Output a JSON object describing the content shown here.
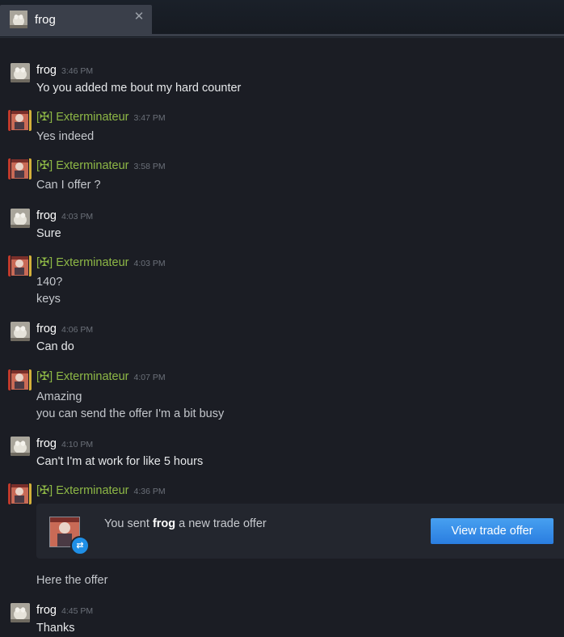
{
  "tab": {
    "label": "frog",
    "close_glyph": "✕"
  },
  "colors": {
    "background": "#1b1d24",
    "friend_name": "#ffffff",
    "other_name": "#8eb846",
    "button": "#3b8fea"
  },
  "messages": [
    {
      "author": "frog",
      "time": "3:46 PM",
      "lines": [
        "Yo you added me bout my hard counter"
      ]
    },
    {
      "author": "[✠] Exterminateur",
      "time": "3:47 PM",
      "lines": [
        "Yes indeed"
      ]
    },
    {
      "author": "[✠] Exterminateur",
      "time": "3:58 PM",
      "lines": [
        "Can I offer ?"
      ]
    },
    {
      "author": "frog",
      "time": "4:03 PM",
      "lines": [
        "Sure"
      ]
    },
    {
      "author": "[✠] Exterminateur",
      "time": "4:03 PM",
      "lines": [
        "140?",
        "keys"
      ]
    },
    {
      "author": "frog",
      "time": "4:06 PM",
      "lines": [
        "Can do"
      ]
    },
    {
      "author": "[✠] Exterminateur",
      "time": "4:07 PM",
      "lines": [
        "Amazing",
        "you can send the offer I'm a bit busy"
      ]
    },
    {
      "author": "frog",
      "time": "4:10 PM",
      "lines": [
        "Can't I'm at work for like 5 hours"
      ]
    },
    {
      "author": "[✠] Exterminateur",
      "time": "4:36 PM",
      "lines": [
        "Here the offer"
      ]
    },
    {
      "author": "frog",
      "time": "4:45 PM",
      "lines": [
        "Thanks"
      ]
    }
  ],
  "trade_offer": {
    "text_before": "You sent ",
    "recipient": "frog",
    "text_after": " a new trade offer",
    "button_label": "View trade offer",
    "badge_icon": "trade-arrows-icon"
  }
}
